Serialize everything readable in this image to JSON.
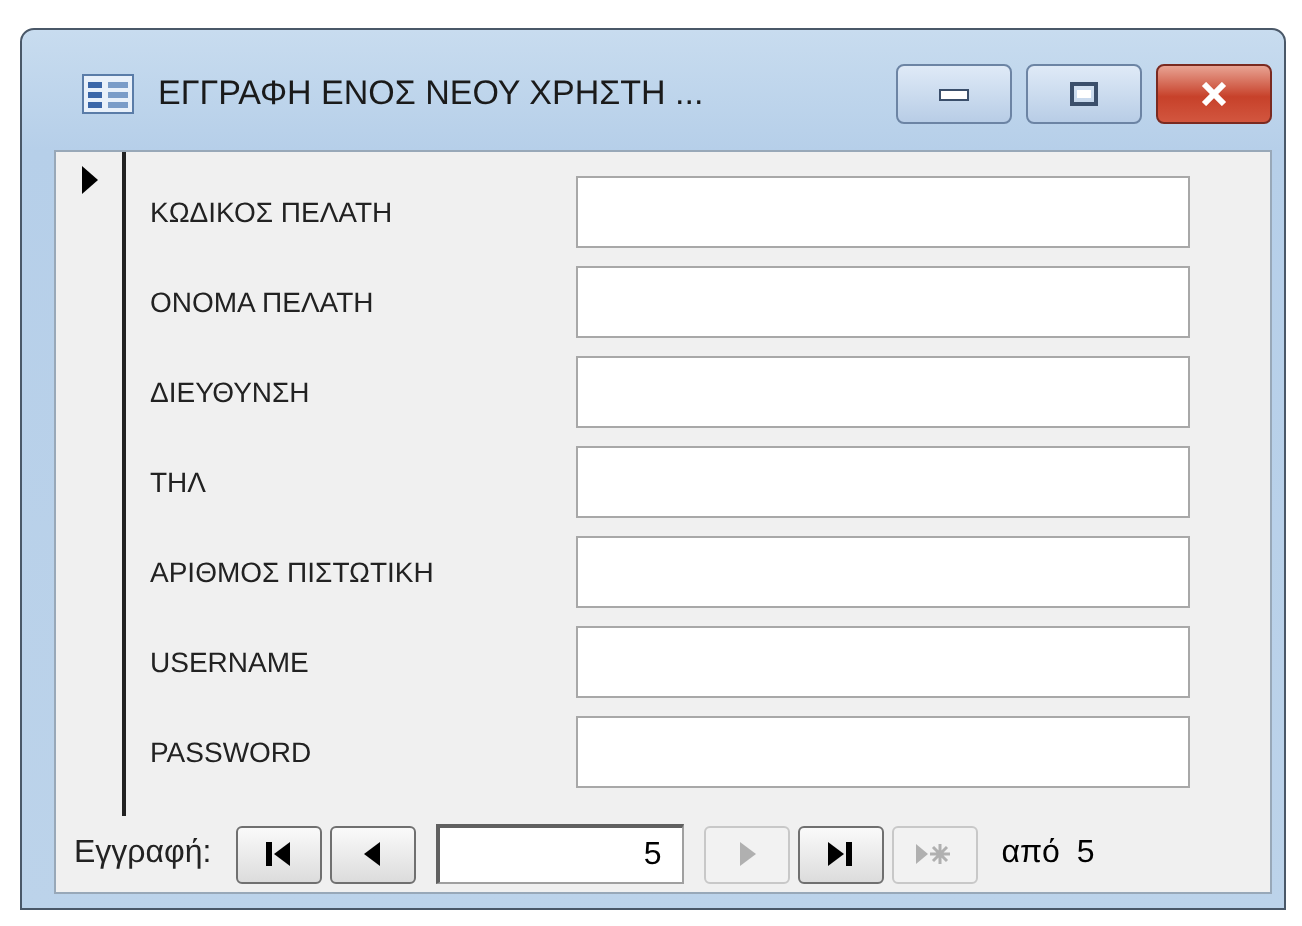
{
  "window": {
    "title": "ΕΓΓΡΑΦΗ ΕΝΟΣ ΝΕΟΥ ΧΡΗΣΤΗ ..."
  },
  "record_selector": {
    "current": true
  },
  "fields": [
    {
      "label": "ΚΩΔΙΚΟΣ ΠΕΛΑΤΗ"
    },
    {
      "label": "ΟΝΟΜΑ ΠΕΛΑΤΗ"
    },
    {
      "label": "ΔΙΕΥΘΥΝΣΗ"
    },
    {
      "label": "ΤΗΛ"
    },
    {
      "label": "ΑΡΙΘΜΟΣ ΠΙΣΤΩΤΙΚΗ"
    },
    {
      "label": "USERNAME"
    },
    {
      "label": "PASSWORD"
    }
  ],
  "navigation": {
    "label": "Εγγραφή:",
    "record": "5",
    "of": "από 5",
    "buttons": [
      {
        "kind": "first",
        "disabled": false
      },
      {
        "kind": "previous",
        "disabled": false
      },
      {
        "kind": "record"
      },
      {
        "kind": "next",
        "disabled": true
      },
      {
        "kind": "last",
        "disabled": false
      },
      {
        "kind": "new",
        "disabled": true
      }
    ]
  }
}
